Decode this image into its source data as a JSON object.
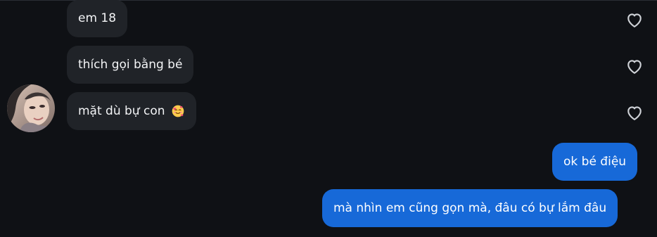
{
  "conversation": {
    "messages": [
      {
        "direction": "in",
        "text": "em 18",
        "emoji": ""
      },
      {
        "direction": "in",
        "text": "thích gọi bằng bé",
        "emoji": ""
      },
      {
        "direction": "in",
        "text": "mặt dù bự con",
        "emoji": "smiling-face-with-hearts"
      },
      {
        "direction": "out",
        "text": "ok bé điệu",
        "emoji": ""
      },
      {
        "direction": "out",
        "text": "mà nhìn em cũng gọn mà, đâu có bự lắm đâu",
        "emoji": ""
      }
    ]
  },
  "icons": {
    "like": "heart-outline-icon",
    "avatar": "contact-avatar"
  },
  "colors": {
    "background": "#0f1115",
    "incoming_bubble": "#202328",
    "outgoing_bubble": "#1769d8",
    "heart_outline": "#d0d3d8"
  }
}
